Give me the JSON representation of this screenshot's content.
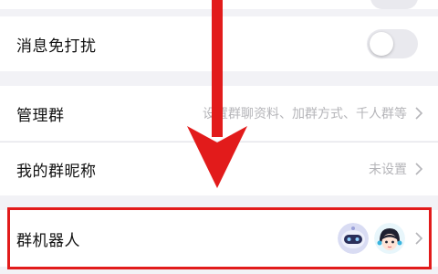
{
  "settings": {
    "do_not_disturb": {
      "label": "消息免打扰",
      "enabled": false
    },
    "manage_group": {
      "label": "管理群",
      "value": "设置群聊资料、加群方式、千人群等"
    },
    "my_nickname": {
      "label": "我的群昵称",
      "value": "未设置"
    },
    "group_robot": {
      "label": "群机器人",
      "avatars": [
        "robot-avatar",
        "girl-avatar"
      ]
    }
  },
  "colors": {
    "highlight": "#e21b1b",
    "background": "#f2f2f6",
    "secondary_text": "#b5b5b9"
  },
  "icons": [
    "chevron-right-icon",
    "arrow-down-icon"
  ]
}
